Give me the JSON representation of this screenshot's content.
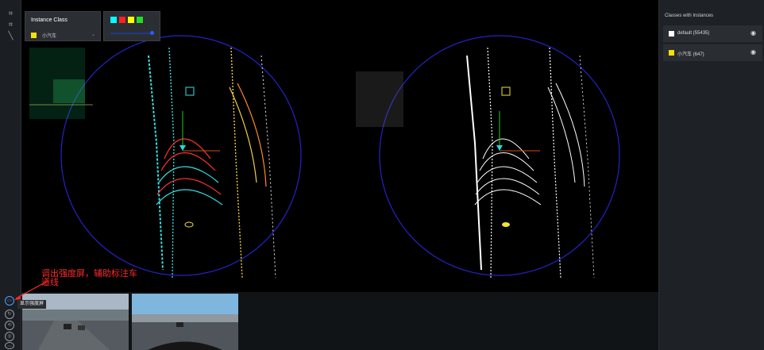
{
  "instance_panel": {
    "title": "Instance Class",
    "selected_class": "小汽车",
    "selected_color": "#f5e10a"
  },
  "color_panel": {
    "swatches": [
      "#00ffff",
      "#ff2020",
      "#ffff00",
      "#22dd22"
    ]
  },
  "sidebar": {
    "title": "Classes with Instances",
    "classes": [
      {
        "label": "default (55435)",
        "color": "#ffffff"
      },
      {
        "label": "小汽车 (647)",
        "color": "#f5e10a"
      }
    ]
  },
  "tooltip": "显示强度屏",
  "annotation": "调出强度屏，辅助标注车道线",
  "icons": {
    "tool_1": "select-tool-icon",
    "tool_2": "box-tool-icon",
    "tool_3": "line-tool-icon",
    "eye": "eye-icon"
  }
}
